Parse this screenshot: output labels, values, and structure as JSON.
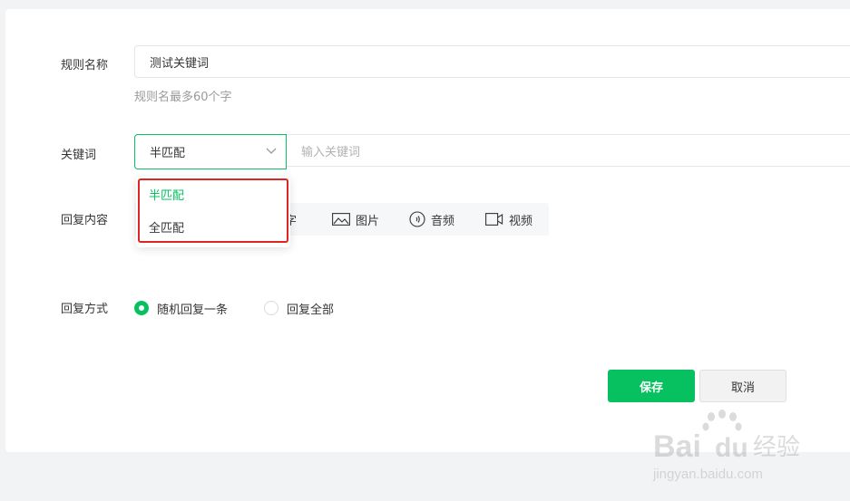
{
  "form": {
    "rule_name": {
      "label": "规则名称",
      "value": "测试关键词",
      "hint": "规则名最多60个字"
    },
    "keyword": {
      "label": "关键词",
      "match_selected": "半匹配",
      "placeholder": "输入关键词",
      "options": [
        "半匹配",
        "全匹配"
      ]
    },
    "reply_content": {
      "label": "回复内容",
      "toolbar": {
        "text_partial": "字",
        "image": "图片",
        "audio": "音频",
        "video": "视频"
      }
    },
    "reply_mode": {
      "label": "回复方式",
      "options": [
        {
          "label": "随机回复一条",
          "selected": true
        },
        {
          "label": "回复全部",
          "selected": false
        }
      ]
    },
    "actions": {
      "save": "保存",
      "cancel": "取消"
    }
  },
  "watermark": {
    "brand": "Bai du 经验",
    "url": "jingyan.baidu.com"
  },
  "colors": {
    "accent": "#07c160",
    "highlight_box": "#e02424"
  }
}
